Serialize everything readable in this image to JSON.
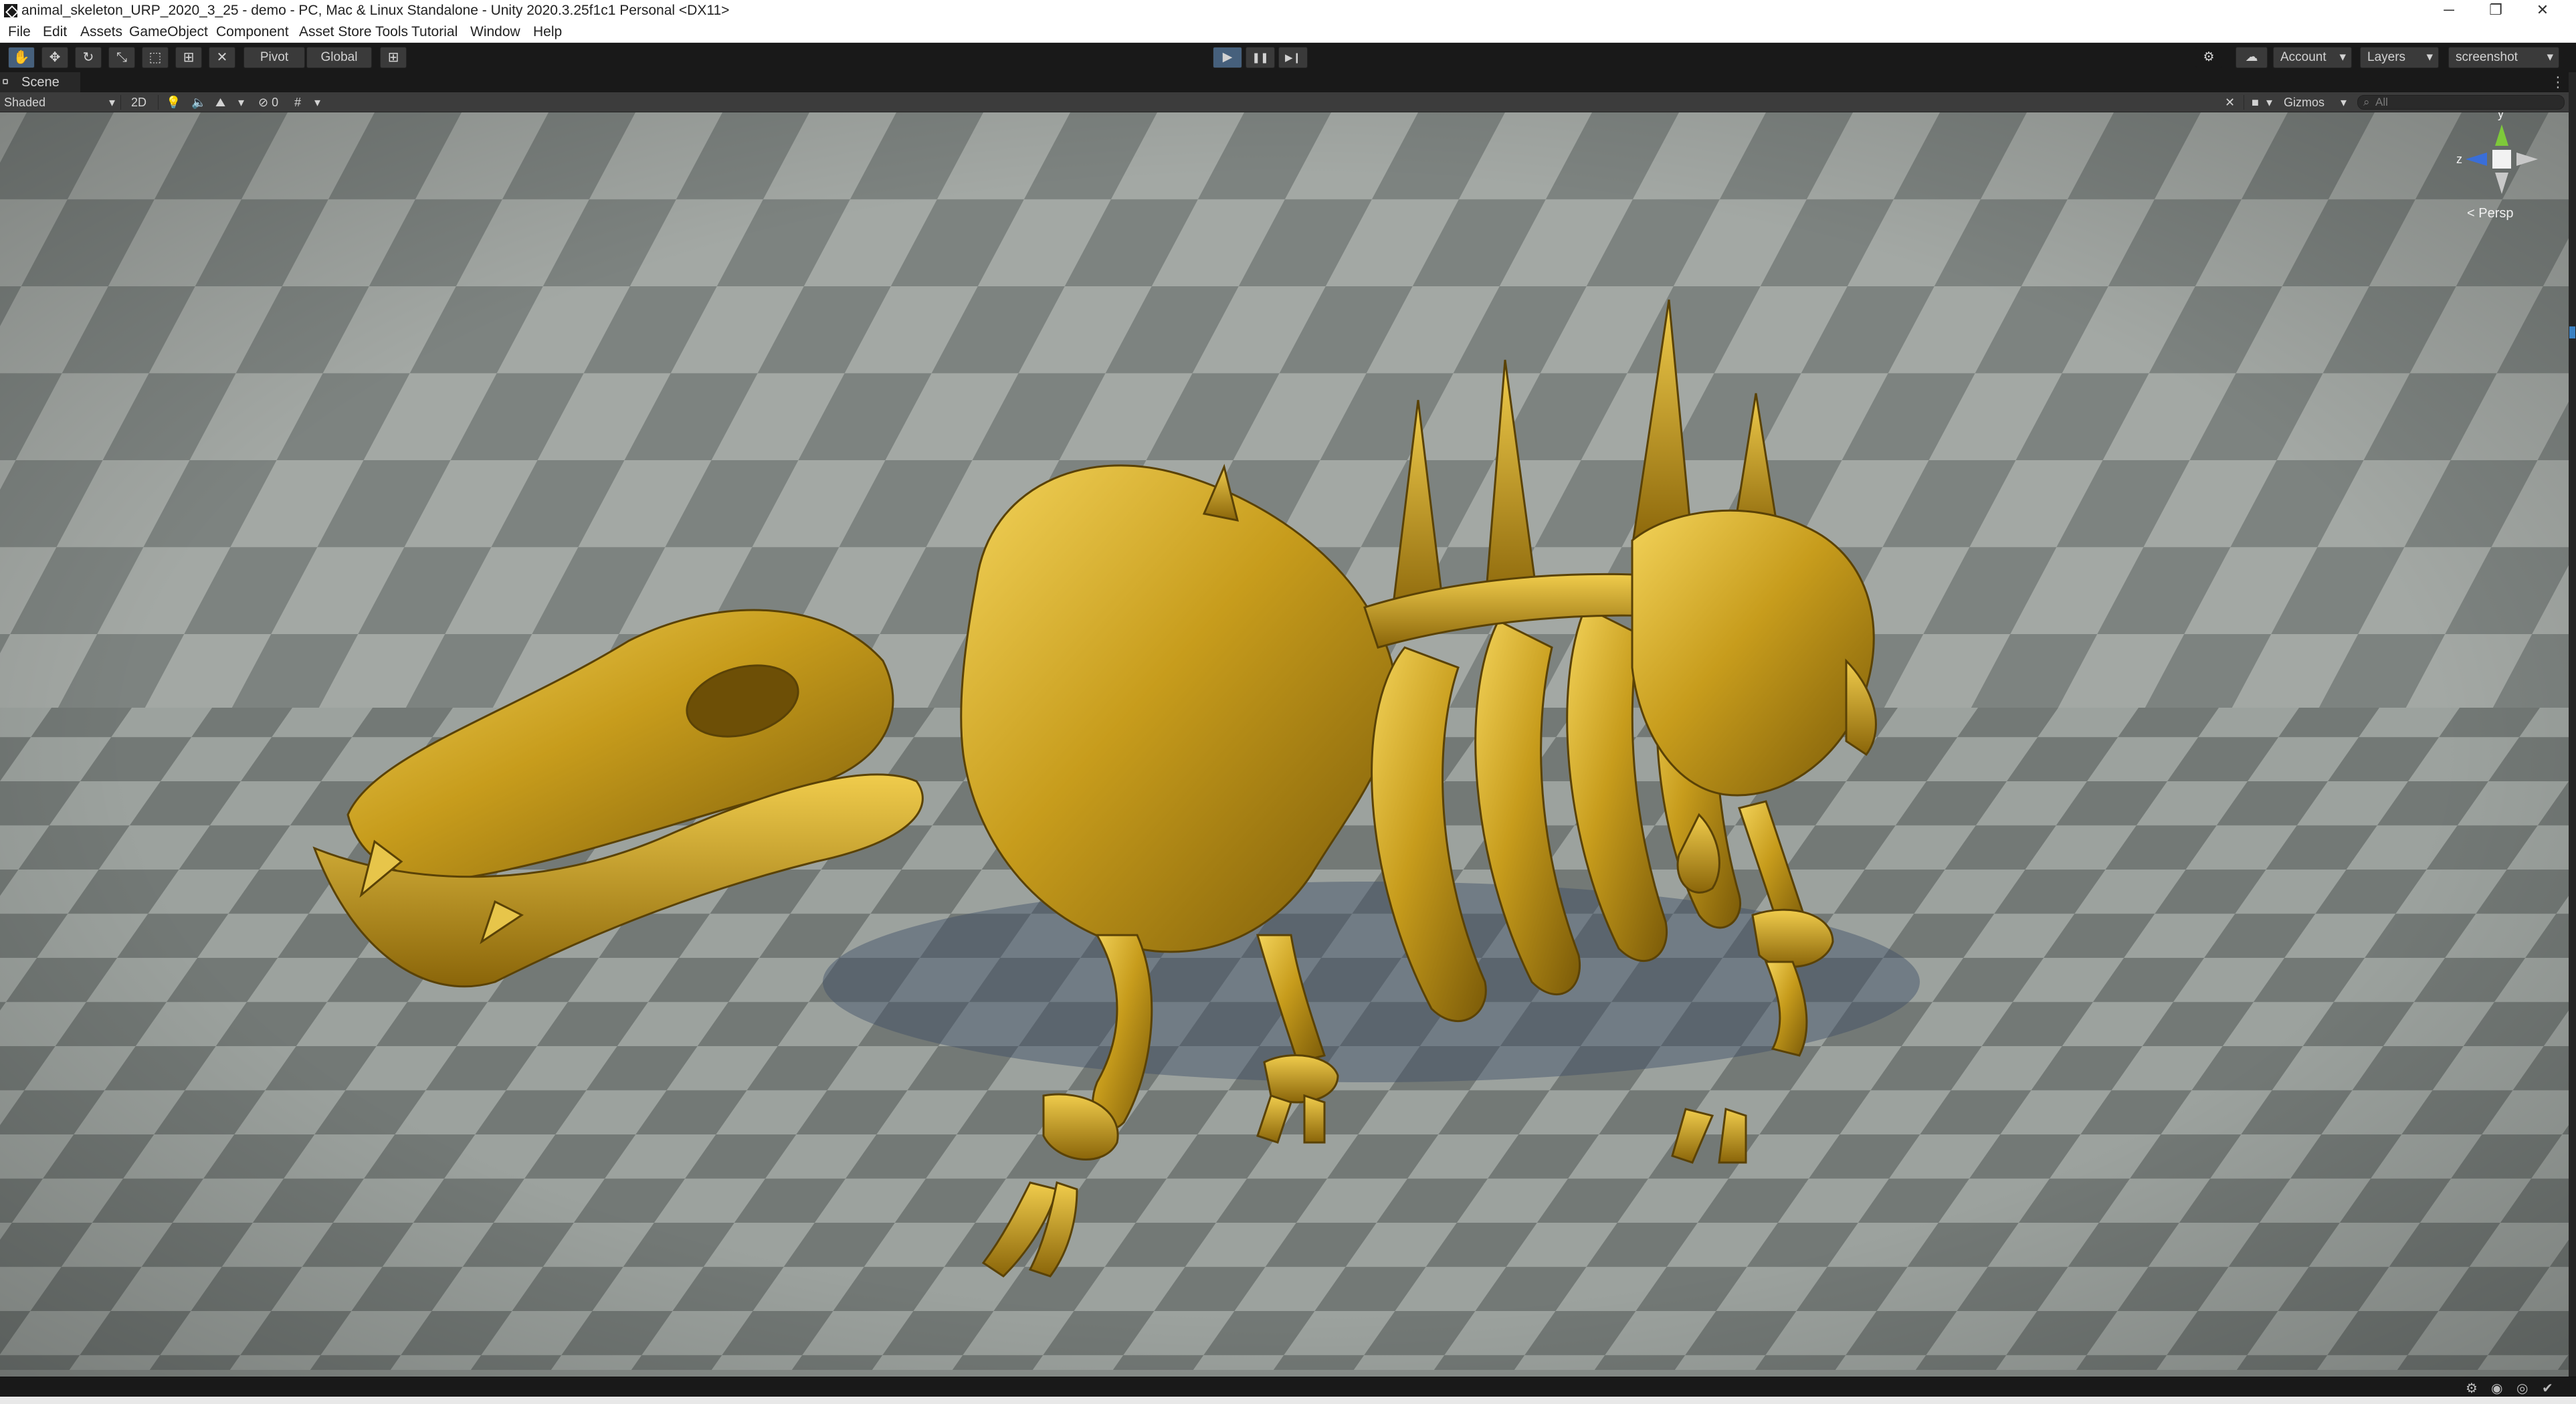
{
  "window": {
    "title": "animal_skeleton_URP_2020_3_25 - demo - PC, Mac & Linux Standalone - Unity 2020.3.25f1c1 Personal <DX11>",
    "controls": {
      "minimize": "─",
      "maximize": "❐",
      "close": "✕"
    }
  },
  "menu": {
    "items": [
      "File",
      "Edit",
      "Assets",
      "GameObject",
      "Component",
      "Asset Store Tools",
      "Tutorial",
      "Window",
      "Help"
    ]
  },
  "toolbar": {
    "tools": [
      {
        "name": "hand-tool",
        "icon": "hand-icon",
        "glyph": "✋",
        "active": true
      },
      {
        "name": "move-tool",
        "icon": "move-icon",
        "glyph": "✥"
      },
      {
        "name": "rotate-tool",
        "icon": "rotate-icon",
        "glyph": "↻"
      },
      {
        "name": "scale-tool",
        "icon": "scale-icon",
        "glyph": "⤡"
      },
      {
        "name": "rect-tool",
        "icon": "rect-icon",
        "glyph": "⬚"
      },
      {
        "name": "transform-tool",
        "icon": "transform-icon",
        "glyph": "⊞"
      },
      {
        "name": "custom-tool",
        "icon": "custom-tool-icon",
        "glyph": "✕"
      }
    ],
    "pivot_label": "Pivot",
    "global_label": "Global",
    "snap_glyph": "⊞",
    "play_glyph": "▶",
    "pause_glyph": "❚❚",
    "step_glyph": "▶❙",
    "settings_glyph": "⚙",
    "cloud_glyph": "☁",
    "account_label": "Account",
    "layers_label": "Layers",
    "layout_label": "screenshot",
    "dropdown_glyph": "▾",
    "accent": "#46607c"
  },
  "scene_tab": {
    "label": "Scene",
    "more_glyph": "⋮"
  },
  "scene_toolbar": {
    "shading_mode": "Shaded",
    "mode_2d": "2D",
    "light_glyph": "💡",
    "audio_glyph": "🔈",
    "effects_glyph": "⛰",
    "hidden_glyph": "⊘",
    "hidden_count": "0",
    "grid_glyph": "#",
    "tools_glyph": "✕",
    "camera_glyph": "■",
    "gizmos_label": "Gizmos",
    "search_placeholder": "All",
    "search_glyph": "⌕"
  },
  "gizmo": {
    "y_label": "y",
    "z_label": "z",
    "projection": "< Persp"
  },
  "status": {
    "icons": [
      "⚙",
      "◉",
      "◎",
      "✔"
    ]
  },
  "colors": {
    "gold": "#c9a020",
    "floor_light": "#9aa09c",
    "floor_dark": "#6f7571",
    "sky": "#8d928f"
  }
}
